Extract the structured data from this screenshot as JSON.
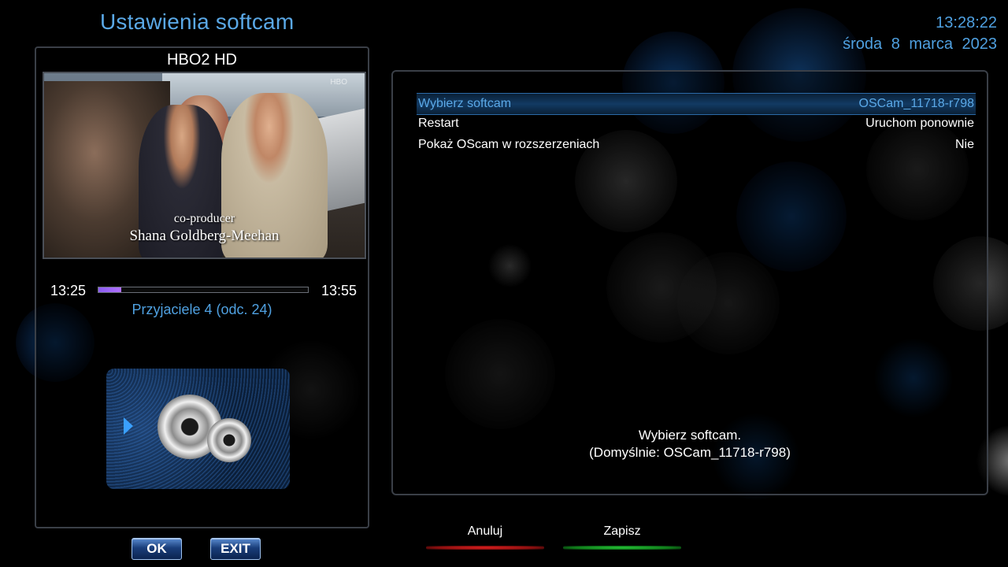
{
  "header": {
    "title": "Ustawienia softcam",
    "time": "13:28:22",
    "date": "środa  8  marca  2023"
  },
  "preview": {
    "channel": "HBO2 HD",
    "caption_line1": "co-producer",
    "caption_line2": "Shana Goldberg-Meehan",
    "watermark": "HBO",
    "start_time": "13:25",
    "end_time": "13:55",
    "progress_percent": 11,
    "program": "Przyjaciele 4 (odc. 24)"
  },
  "menu": {
    "items": [
      {
        "label": "Wybierz softcam",
        "value": "OSCam_11718-r798",
        "selected": true
      },
      {
        "label": "Restart",
        "value": "Uruchom ponownie",
        "selected": false
      },
      {
        "label": "Pokaż OScam w rozszerzeniach",
        "value": "Nie",
        "selected": false
      }
    ],
    "help_line1": "Wybierz softcam.",
    "help_line2": "(Domyślnie: OSCam_11718-r798)"
  },
  "buttons": {
    "ok": "OK",
    "exit": "EXIT",
    "red": "Anuluj",
    "green": "Zapisz"
  },
  "colors": {
    "accent": "#5aa8e6",
    "red_key": "#c81e1e",
    "green_key": "#1fa82e"
  }
}
